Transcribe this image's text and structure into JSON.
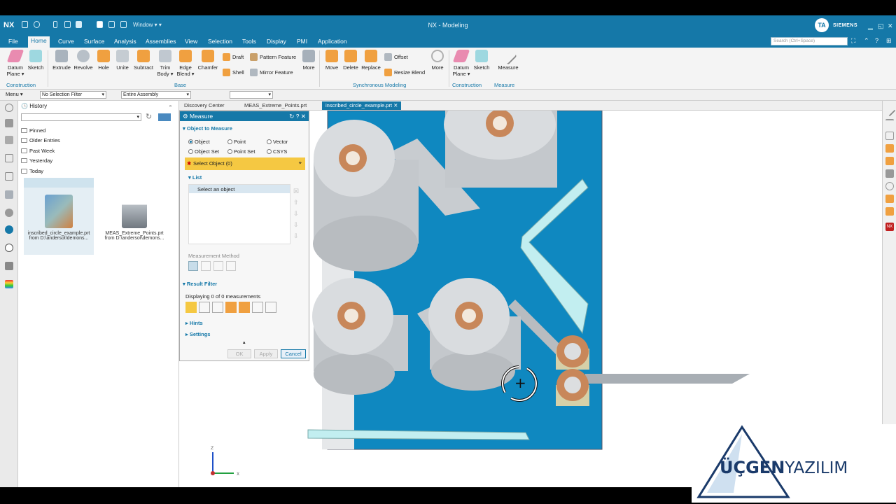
{
  "app": {
    "logo": "NX",
    "window_menu": "Window ▾ ▾",
    "title": "NX - Modeling",
    "user_initials": "TA",
    "brand": "SIEMENS"
  },
  "menu_tabs": [
    "File",
    "Home",
    "Curve",
    "Surface",
    "Analysis",
    "Assemblies",
    "View",
    "Selection",
    "Tools",
    "Display",
    "PMI",
    "Application"
  ],
  "search": {
    "placeholder": "Search (Ctrl+Space)"
  },
  "ribbon": {
    "construction": {
      "datum_plane": "Datum\nPlane ▾",
      "sketch": "Sketch",
      "label": "Construction"
    },
    "base": {
      "extrude": "Extrude",
      "revolve": "Revolve",
      "hole": "Hole",
      "unite": "Unite",
      "subtract": "Subtract",
      "trim_body": "Trim\nBody ▾",
      "edge_blend": "Edge\nBlend ▾",
      "chamfer": "Chamfer",
      "draft": "Draft",
      "shell": "Shell",
      "pattern_feature": "Pattern Feature",
      "mirror_feature": "Mirror Feature",
      "more": "More",
      "label": "Base"
    },
    "sync": {
      "move": "Move",
      "delete": "Delete",
      "replace": "Replace",
      "offset": "Offset",
      "resize_blend": "Resize Blend",
      "more": "More",
      "label": "Synchronous Modeling"
    },
    "construction2": {
      "datum_plane": "Datum\nPlane ▾",
      "sketch": "Sketch",
      "label": "Construction"
    },
    "measure": {
      "measure": "Measure",
      "label": "Measure"
    }
  },
  "selection_bar": {
    "menu": "Menu ▾",
    "filter": "No Selection Filter",
    "scope": "Entire Assembly"
  },
  "history": {
    "title": "History",
    "folders": [
      "Pinned",
      "Older Entries",
      "Past Week",
      "Yesterday",
      "Today"
    ],
    "files": [
      {
        "name": "inscribed_circle_example.prt",
        "path": "from D:\\andersot\\demons..."
      },
      {
        "name": "MEAS_Extreme_Points.prt",
        "path": "from D:\\andersot\\demons..."
      }
    ]
  },
  "doc_tabs": [
    "Discovery Center",
    "MEAS_Extreme_Points.prt",
    "inscribed_circle_example.prt"
  ],
  "measure": {
    "title": "Measure",
    "object_section": "Object to Measure",
    "types": [
      "Object",
      "Point",
      "Vector",
      "Object Set",
      "Point Set",
      "CSYS"
    ],
    "select_object": "Select Object (0)",
    "list_section": "List",
    "list_prompt": "Select an object",
    "method_label": "Measurement Method",
    "result_filter": "Result Filter",
    "displaying": "Displaying 0 of 0 measurements",
    "hints": "Hints",
    "settings": "Settings",
    "ok": "OK",
    "apply": "Apply",
    "cancel": "Cancel"
  },
  "triad": {
    "x": "X",
    "z": "Z"
  },
  "logo": {
    "part1": "ÜÇGEN",
    "part2": "YAZILIM"
  },
  "colors": {
    "accent": "#1578a8",
    "model_plate": "#0f88c0",
    "copper": "#c8875a",
    "logo_blue": "#1a3a6a"
  }
}
